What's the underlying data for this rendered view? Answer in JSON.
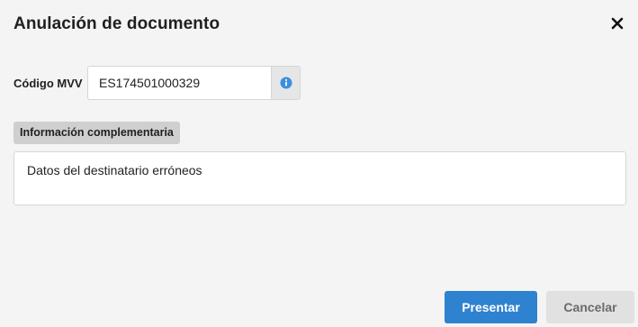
{
  "dialog": {
    "title": "Anulación de documento",
    "close_icon": "close-icon"
  },
  "form": {
    "code_label": "Código MVV",
    "code_value": "ES174501000329",
    "info_icon": "info-icon",
    "complementary_label": "Información complementaria",
    "complementary_value": "Datos del destinatario erróneos"
  },
  "actions": {
    "submit_label": "Presentar",
    "cancel_label": "Cancelar"
  },
  "colors": {
    "background": "#f4f4f4",
    "primary": "#2f82cf",
    "secondary": "#e1e1e1",
    "info_icon": "#3a8fe0",
    "section_label_bg": "#cfcfcf"
  }
}
